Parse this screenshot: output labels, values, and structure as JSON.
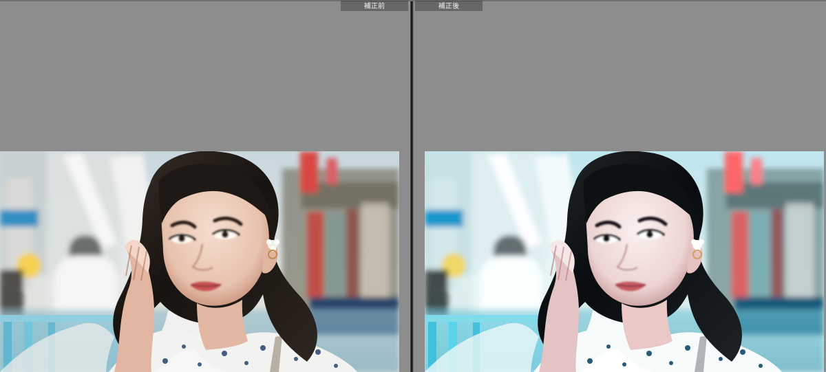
{
  "window": {
    "layout": "before-after-side-by-side"
  },
  "comparison": {
    "before_label": "補正前",
    "after_label": "補正後"
  },
  "colors": {
    "workspace_gray": "#8d8d8d",
    "tab_gray": "#666666",
    "divider_dark": "#1b1b1b",
    "tab_text": "#f1f1f1"
  },
  "photos": {
    "before": {
      "subject": "woman-portrait"
    },
    "after": {
      "subject": "woman-portrait"
    }
  }
}
